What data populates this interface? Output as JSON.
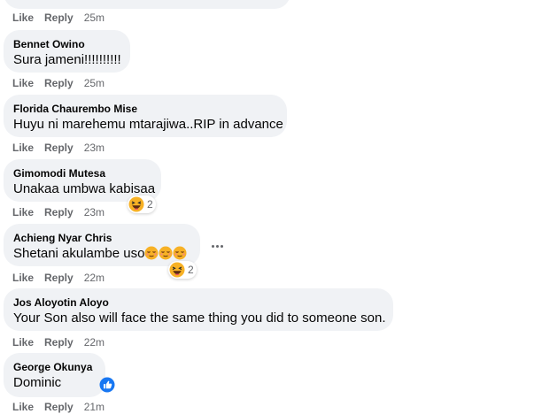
{
  "comments": [
    {
      "author": "",
      "text": "",
      "like": "Like",
      "reply": "Reply",
      "time": "25m"
    },
    {
      "author": "Bennet Owino",
      "text": "Sura jameni!!!!!!!!!!",
      "like": "Like",
      "reply": "Reply",
      "time": "25m"
    },
    {
      "author": "Florida Chaurembo Mise",
      "text": "Huyu ni marehemu mtarajiwa..RIP in advance",
      "like": "Like",
      "reply": "Reply",
      "time": "23m"
    },
    {
      "author": "Gimomodi Mutesa",
      "text": "Unakaa umbwa kabisaa",
      "like": "Like",
      "reply": "Reply",
      "time": "23m",
      "reaction": {
        "icon": "haha-emoji-icon",
        "count": "2"
      }
    },
    {
      "author": "Achieng Nyar Chris",
      "text": "Shetani akulambe uso",
      "like": "Like",
      "reply": "Reply",
      "time": "22m",
      "reaction": {
        "icon": "haha-emoji-icon",
        "count": "2"
      },
      "inline_emoji": "relieved-emoji-icon"
    },
    {
      "author": "Jos Aloyotin Aloyo",
      "text": "Your Son also will face the same thing you did to someone son.",
      "like": "Like",
      "reply": "Reply",
      "time": "22m"
    },
    {
      "author": "George Okunya",
      "text": "Dominic",
      "like": "Like",
      "reply": "Reply",
      "time": "21m",
      "reaction": {
        "icon": "like-thumb-icon"
      }
    }
  ],
  "colors": {
    "bubble": "#f0f2f5",
    "secondary_text": "#65676b",
    "like_blue": "#1877f2",
    "haha_yellow": "#f7b125"
  }
}
